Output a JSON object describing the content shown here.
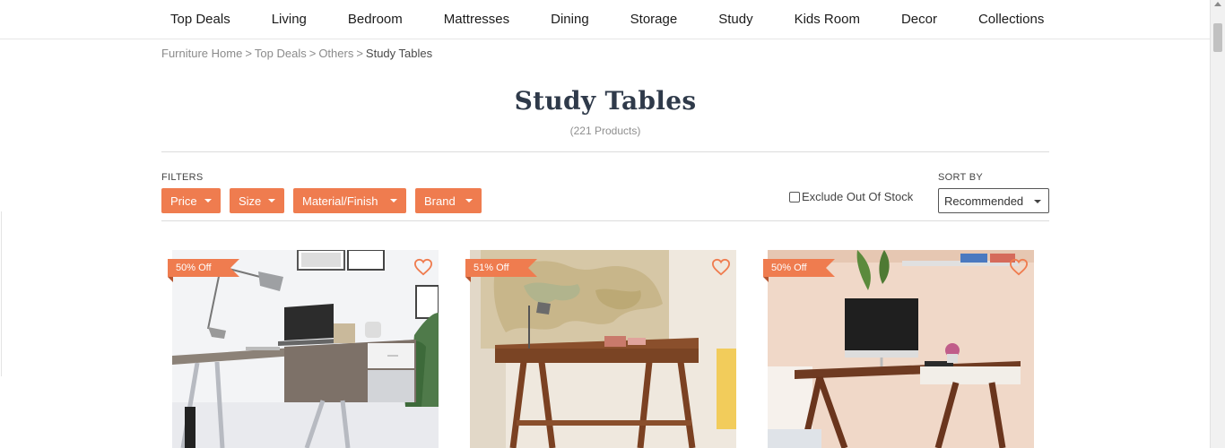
{
  "nav": {
    "items": [
      "Top Deals",
      "Living",
      "Bedroom",
      "Mattresses",
      "Dining",
      "Storage",
      "Study",
      "Kids Room",
      "Decor",
      "Collections"
    ]
  },
  "breadcrumb": {
    "items": [
      "Furniture Home",
      "Top Deals",
      "Others"
    ],
    "separator": ">",
    "current": "Study Tables"
  },
  "page": {
    "title": "Study Tables",
    "count": "(221 Products)"
  },
  "filters": {
    "label": "FILTERS",
    "buttons": [
      "Price",
      "Size",
      "Material/Finish",
      "Brand"
    ],
    "exclude_out_of_stock": "Exclude Out Of Stock",
    "exclude_checked": false
  },
  "sort": {
    "label": "SORT BY",
    "selected": "Recommended"
  },
  "products": [
    {
      "discount": "50% Off",
      "icon": "heart-icon"
    },
    {
      "discount": "51% Off",
      "icon": "heart-icon"
    },
    {
      "discount": "50% Off",
      "icon": "heart-icon"
    }
  ],
  "colors": {
    "accent": "#ef7c4f",
    "title": "#2f3a4a"
  }
}
